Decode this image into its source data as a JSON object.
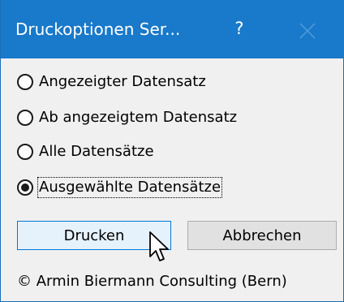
{
  "window": {
    "title": "Druckoptionen Ser...",
    "help_label": "?",
    "close_icon": "close-icon",
    "accent_color": "#1979ca"
  },
  "options": {
    "items": [
      {
        "label": "Angezeigter Datensatz",
        "checked": false
      },
      {
        "label": "Ab angezeigtem Datensatz",
        "checked": false
      },
      {
        "label": "Alle Datensätze",
        "checked": false
      },
      {
        "label": "Ausgewählte Datensätze",
        "checked": true
      }
    ]
  },
  "buttons": {
    "print_label": "Drucken",
    "cancel_label": "Abbrechen"
  },
  "footer": {
    "copyright": "© Armin Biermann Consulting (Bern)"
  },
  "pointer_icon": "arrow-cursor-icon"
}
